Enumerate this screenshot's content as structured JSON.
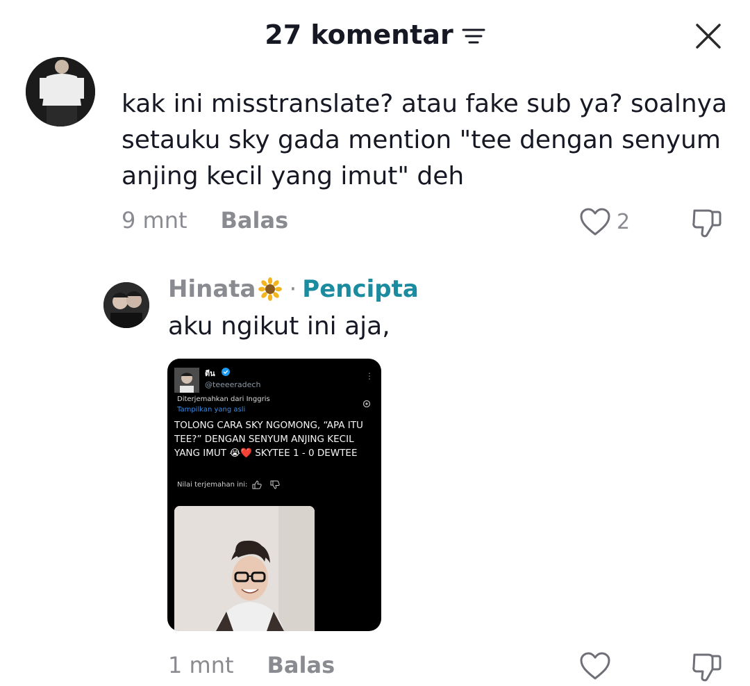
{
  "header": {
    "title": "27 komentar",
    "sort_icon": "sort-icon",
    "close_icon": "close-icon"
  },
  "comments": [
    {
      "text": "kak ini misstranslate? atau fake sub ya? soalnya setauku sky gada mention \"tee dengan senyum anjing kecil yang imut\" deh",
      "time": "9 mnt",
      "reply_label": "Balas",
      "likes": "2"
    }
  ],
  "reply": {
    "username": "Hinata",
    "separator": "·",
    "badge": "Pencipta",
    "text": "aku ngikut ini aja,",
    "time": "1 mnt",
    "reply_label": "Balas",
    "embed": {
      "name": "ตีน",
      "handle": "@teeeeradech",
      "more": "⋮",
      "translated_label": "Diterjemahkan dari Inggris",
      "show_original": "Tampilkan yang asli",
      "body": "TOLONG CARA SKY NGOMONG, “APA ITU TEE?” DENGAN SENYUM ANJING KECIL YANG IMUT 😭❤️ SKYTEE 1 - 0 DEWTEE",
      "rate_label": "Nilai terjemahan ini:"
    }
  },
  "colors": {
    "muted": "#8a8b91",
    "creator": "#1b8ca0",
    "text": "#161823"
  }
}
